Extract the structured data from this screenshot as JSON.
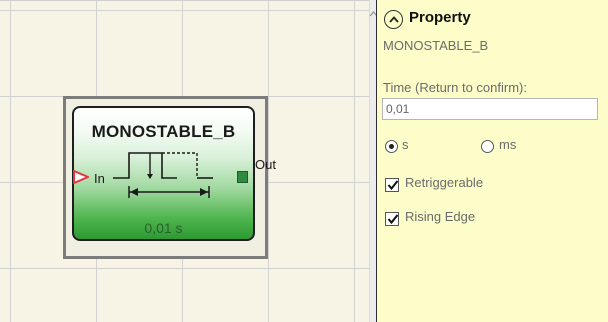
{
  "canvas": {
    "block": {
      "title": "MONOSTABLE_B",
      "value": "0,01 s",
      "input_label": "In",
      "output_label": "Out"
    }
  },
  "property_panel": {
    "title": "Property",
    "block_name": "MONOSTABLE_B",
    "time_label": "Time (Return to confirm):",
    "time_value": "0,01",
    "unit_options": [
      {
        "label": "s",
        "selected": true
      },
      {
        "label": "ms",
        "selected": false
      }
    ],
    "checkboxes": [
      {
        "label": "Retriggerable",
        "checked": true
      },
      {
        "label": "Rising Edge",
        "checked": true
      }
    ]
  },
  "icons": {
    "collapse": "chevron-up-circle-icon",
    "scroll_up": "scroll-up-arrow-icon",
    "input_port": "input-arrow-icon",
    "output_port": "output-port-icon",
    "pulse": "monostable-pulse-icon"
  },
  "colors": {
    "canvas_bg": "#f7f4e5",
    "panel_bg": "#fdfdc9",
    "block_green": "#2c9a32",
    "input_arrow": "#e8323c",
    "output_port": "#2e8b3f"
  }
}
